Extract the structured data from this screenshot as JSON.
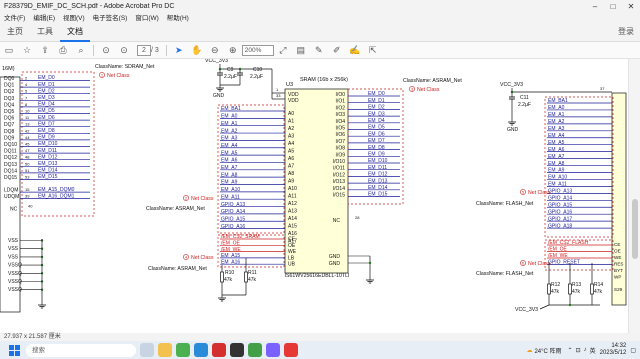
{
  "window": {
    "title": "F28379D_EMIF_DC_SCH.pdf - Adobe Acrobat Pro DC"
  },
  "menu": [
    "文件(F)",
    "编辑(E)",
    "视图(V)",
    "电子签名(S)",
    "窗口(W)",
    "帮助(H)"
  ],
  "tabs": [
    "主页",
    "工具",
    "文档"
  ],
  "login": "登录",
  "toolbar": {
    "page_current": "2",
    "page_total": "/ 3",
    "zoom": "200%"
  },
  "status": {
    "page_size": "27.937 x 21.587 厘米"
  },
  "taskbar": {
    "search_placeholder": "搜索",
    "weather": "24°C 阵雨",
    "lang": "英",
    "time": "14:32",
    "date": "2023/5/12"
  },
  "schematic": {
    "left_header": "16M)",
    "left_class": "ClassName: SDRAM_Net",
    "net_class": "Net Class",
    "left_pins": [
      "DQ0",
      "DQ1",
      "DQ2",
      "DQ3",
      "DQ4",
      "DQ5",
      "DQ6",
      "DQ7",
      "DQ8",
      "DQ9",
      "DQ10",
      "DQ11",
      "DQ12",
      "DQ13",
      "DQ14",
      "DQ15"
    ],
    "left_nets": [
      "EM_D0",
      "EM_D1",
      "EM_D2",
      "EM_D3",
      "EM_D4",
      "EM_D5",
      "EM_D6",
      "EM_D7",
      "EM_D8",
      "EM_D9",
      "EM_D10",
      "EM_D11",
      "EM_D12",
      "EM_D13",
      "EM_D14",
      "EM_D15"
    ],
    "left_pin_nums": [
      "2",
      "4",
      "5",
      "7",
      "8",
      "10",
      "11",
      "13",
      "42",
      "44",
      "45",
      "47",
      "48",
      "50",
      "51",
      "53"
    ],
    "ldqm": "LDQM",
    "udqm": "UDQM",
    "dqm_nets": [
      "EM_A15_DQM0",
      "EM_A16_DQM1"
    ],
    "nc": "NC",
    "vss_pins": [
      "VSS",
      "VSS",
      "VSS",
      "VSSQ",
      "VSSQ",
      "VSSQ",
      "VSSQ"
    ],
    "vcc_3v3": "VCC_3V3",
    "c9": "C9",
    "c9_val": "2.2µF",
    "c10": "C10",
    "c10_val": "2.2µF",
    "c11": "C11",
    "c11_val": "2.2µF",
    "u3": "U3",
    "u3_title": "SRAM (16b x 256k)",
    "u3_part": "IS61WV25616EDBLL-10TLI",
    "vdd": "VDD",
    "sram_addr_nets": [
      "EM_BA1",
      "EM_A0",
      "EM_A1",
      "EM_A2",
      "EM_A3",
      "EM_A4",
      "EM_A5",
      "EM_A6",
      "EM_A7",
      "EM_A8",
      "EM_A9",
      "EM_A10",
      "EM_A11",
      "GPIO_A13",
      "GPIO_A14",
      "GPIO_A15",
      "GPIO_A16"
    ],
    "sram_addr_pins": [
      "A0",
      "A1",
      "A2",
      "A3",
      "A4",
      "A5",
      "A6",
      "A7",
      "A8",
      "A9",
      "A10",
      "A11",
      "A12",
      "A13",
      "A14",
      "A15",
      "A16",
      "A17"
    ],
    "sram_io_pins": [
      "I/O0",
      "I/O1",
      "I/O2",
      "I/O3",
      "I/O4",
      "I/O5",
      "I/O6",
      "I/O7",
      "I/O8",
      "I/O9",
      "I/O10",
      "I/O11",
      "I/O12",
      "I/O13",
      "I/O14",
      "I/O15"
    ],
    "asram_class": "ClassName: ASRAM_Net",
    "ctrl_nets": [
      "/EM_CS2_SRAM",
      "/EM_OE",
      "/EM_WE",
      "EM_A15",
      "EM_A16"
    ],
    "ctrl_pins": [
      "CE",
      "OE",
      "WE",
      "LB",
      "UB"
    ],
    "gnd": "GND",
    "r10": "R10",
    "r11": "R11",
    "res_val": "47k",
    "right_header": "37",
    "flash_class": "ClassName: FLASH_Net",
    "flash_addr_nets": [
      "EM_BA1",
      "EM_A0",
      "EM_A1",
      "EM_A2",
      "EM_A3",
      "EM_A4",
      "EM_A5",
      "EM_A6",
      "EM_A7",
      "EM_A8",
      "EM_A9",
      "EM_A10",
      "EM_A11",
      "GPIO_A13",
      "GPIO_A14",
      "GPIO_A15",
      "GPIO_A16",
      "GPIO_A17",
      "GPIO_A18"
    ],
    "flash_ctrl_nets": [
      "/EM_CS2_FLASH",
      "/EM_OE",
      "/EM_WE",
      "GPIO_RESET"
    ],
    "flash_ctrl_pins": [
      "CE",
      "OE",
      "WE",
      "RES",
      "BYT",
      "WP"
    ],
    "r12": "R12",
    "r13": "R13",
    "r14": "R14",
    "flash_part": "S29"
  }
}
